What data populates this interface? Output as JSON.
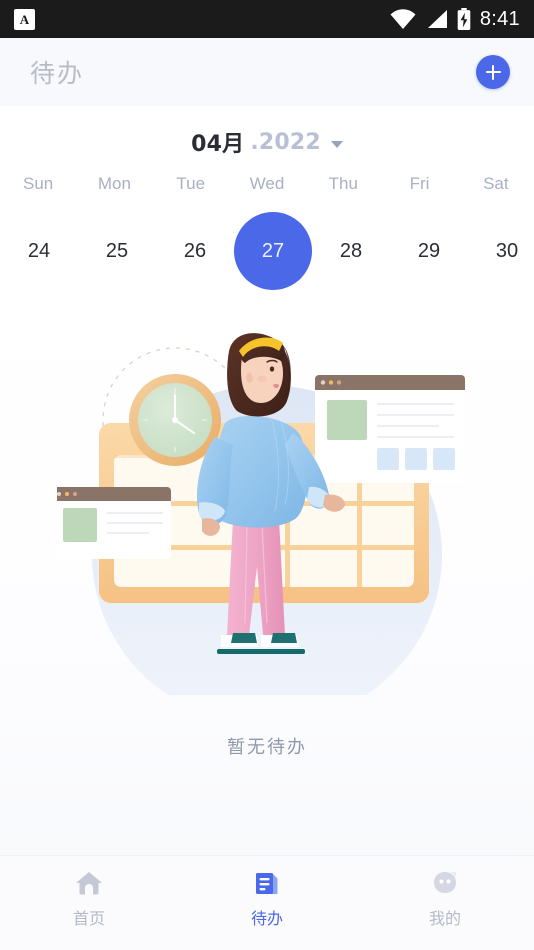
{
  "status_bar": {
    "app_badge": "A",
    "time": "8:41",
    "icons": [
      "wifi-icon",
      "cellular-signal-icon",
      "battery-charging-icon"
    ],
    "background": "#1b1b1b"
  },
  "header": {
    "title": "待办",
    "add_button_label": "+",
    "add_button_name": "add-todo-button",
    "accent": "#4a68e8",
    "background": "#f8f9fc"
  },
  "calendar": {
    "month": "04月",
    "year": ".2022",
    "caret": "chevron-down-icon",
    "weekdays": [
      "Sun",
      "Mon",
      "Tue",
      "Wed",
      "Thu",
      "Fri",
      "Sat"
    ],
    "dates": [
      {
        "day": "24",
        "selected": false
      },
      {
        "day": "25",
        "selected": false
      },
      {
        "day": "26",
        "selected": false
      },
      {
        "day": "27",
        "selected": true
      },
      {
        "day": "28",
        "selected": false
      },
      {
        "day": "29",
        "selected": false
      },
      {
        "day": "30",
        "selected": false
      }
    ],
    "selected_color": "#4a68e8",
    "weekday_color": "#a9b0c4"
  },
  "empty_state": {
    "message": "暂无待办",
    "illustration_name": "woman-with-calendar-board-illustration",
    "colors": {
      "backdrop": "#dfe6f4",
      "board_frame": "#f8cf96",
      "board_cell": "#fffaf0",
      "clock_rim": "#eeba72",
      "clock_face": "#cfe2cc",
      "sweater": "#9ecbef",
      "pants": "#f0a9c8",
      "hair": "#4b2b21",
      "headband": "#f6c32a",
      "skin": "#f6d0bb",
      "sandals": "#1f7070",
      "card_titlebar": "#8a7468",
      "card_body": "#ffffff",
      "card_thumb": "#bcd8b8",
      "card_tile": "#d7e7f7"
    }
  },
  "bottom_nav": {
    "items": [
      {
        "label": "首页",
        "icon": "home-icon",
        "active": false
      },
      {
        "label": "待办",
        "icon": "document-list-icon",
        "active": true
      },
      {
        "label": "我的",
        "icon": "profile-avatar-icon",
        "active": false
      }
    ],
    "active_color": "#4a68e8",
    "inactive_color": "#b4bac9"
  }
}
